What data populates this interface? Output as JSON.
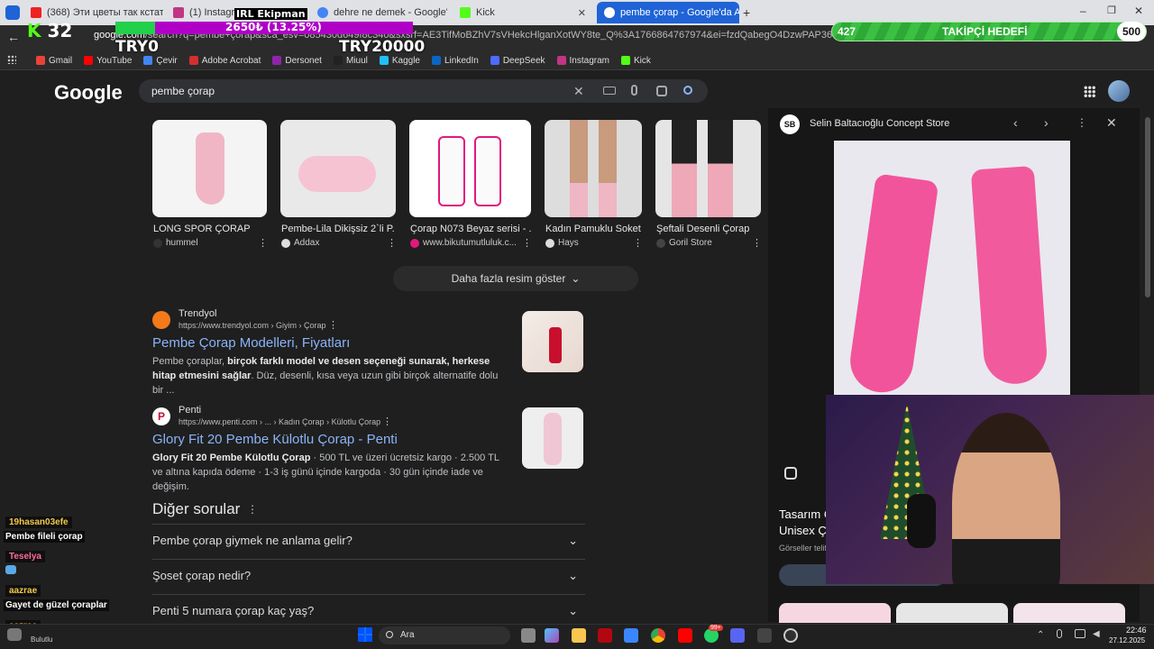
{
  "tabs": [
    {
      "label": "(368) Эти цветы так кстати",
      "color": "#e22"
    },
    {
      "label": "(1) Instagram",
      "color": "#c13584"
    },
    {
      "label": "dehre ne demek - Google'da A",
      "color": "#4285f4"
    },
    {
      "label": "Kick",
      "color": "#53fc18"
    },
    {
      "label": "pembe çorap - Google'da Ara",
      "color": "#4285f4"
    }
  ],
  "address": {
    "url_prefix": "google.com",
    "url_rest": "/search?q=pembe+çorap&sca_esv=085430d649f8c340&sxsrf=AE3TifMoBZhV7sVHekcHlganXotWY8te_Q%3A1766864767974&ei=fzdQabegO4DzwPAP36Wv6Q8&ved=0ahUKEwj32_GWx"
  },
  "bookmarks": [
    {
      "label": "Gmail",
      "color": "#ea4335"
    },
    {
      "label": "YouTube",
      "color": "#ff0000"
    },
    {
      "label": "Çevir",
      "color": "#4285f4"
    },
    {
      "label": "Adobe Acrobat",
      "color": "#d32f2f"
    },
    {
      "label": "Dersonet",
      "color": "#8e24aa"
    },
    {
      "label": "Miuul",
      "color": "#222"
    },
    {
      "label": "Kaggle",
      "color": "#20beff"
    },
    {
      "label": "LinkedIn",
      "color": "#0a66c2"
    },
    {
      "label": "DeepSeek",
      "color": "#4d6bfe"
    },
    {
      "label": "Instagram",
      "color": "#c13584"
    },
    {
      "label": "Kick",
      "color": "#53fc18"
    }
  ],
  "overlay": {
    "channel_number": "32",
    "donation_text": "2650₺ (13.25%)",
    "goal_progress": 0.1325,
    "try_left": "TRY0",
    "try_right": "TRY20000",
    "overlap_name": "IRL Ekipman",
    "follower_count": "427",
    "follower_label": "TAKİPÇİ HEDEFİ",
    "follower_target": "500"
  },
  "google": {
    "logo": "Google",
    "query": "pembe çorap",
    "images": [
      {
        "title": "LONG SPOR ÇORAP",
        "source": "hummel",
        "color": "#f0b6c6"
      },
      {
        "title": "Pembe-Lila Dikişsiz 2`li P...",
        "source": "Addax",
        "color": "#f6c3d3"
      },
      {
        "title": "Çorap N073 Beyaz serisi - ...",
        "source": "www.bikutumutluluk.c...",
        "color": "#fafafa"
      },
      {
        "title": "Kadın Pamuklu Soket...",
        "source": "Hays",
        "color": "#efb6c4"
      },
      {
        "title": "Şeftali Desenli Çorap",
        "source": "Goril Store",
        "color": "#eea8b8"
      }
    ],
    "more_images": "Daha fazla resim göster",
    "results": [
      {
        "site": "Trendyol",
        "url": "https://www.trendyol.com › Giyim › Çorap",
        "title": "Pembe Çorap Modelleri, Fiyatları",
        "snippet_pre": "Pembe çoraplar, ",
        "snippet_bold": "birçok farklı model ve desen seçeneği sunarak, herkese hitap etmesini sağlar",
        "snippet_post": ". Düz, desenli, kısa veya uzun gibi birçok alternatife dolu bir ..."
      },
      {
        "site": "Penti",
        "url": "https://www.penti.com › ... › Kadın Çorap › Külotlu Çorap",
        "title": "Glory Fit 20 Pembe Külotlu Çorap - Penti",
        "snippet_pre": "",
        "snippet_bold": "Glory Fit 20 Pembe Külotlu Çorap",
        "snippet_post": " · 500 TL ve üzeri ücretsiz kargo · 2.500 TL ve altına kapıda ödeme · 1-3 iş günü içinde kargoda · 30 gün içinde iade ve değişim."
      }
    ],
    "paa_title": "Diğer sorular",
    "paa": [
      "Pembe çorap giymek ne anlama gelir?",
      "Şoset çorap nedir?",
      "Penti 5 numara çorap kaç yaş?"
    ]
  },
  "panel": {
    "store": "Selin Baltacıoğlu Concept Store",
    "store_badge": "SB",
    "title_line1": "Tasarım Ç",
    "title_line2": "Unisex Ç",
    "footer": "Görseller telif"
  },
  "chat": [
    {
      "user": "19hasan03efe",
      "message": "Pembe fileli çorap",
      "user_color": "#f2c94c"
    },
    {
      "user": "Teselya",
      "message": "",
      "user_color": "#ff6b9d"
    },
    {
      "user": "aazrae",
      "message": "Gayet de güzel çoraplar",
      "user_color": "#f2c94c"
    },
    {
      "user": "aazrae",
      "message": "",
      "user_color": "#f2c94c"
    }
  ],
  "taskbar": {
    "search": "Ara",
    "weather": "Bulutlu",
    "time": "22:46",
    "date": "27.12.2025",
    "badge": "99+"
  }
}
